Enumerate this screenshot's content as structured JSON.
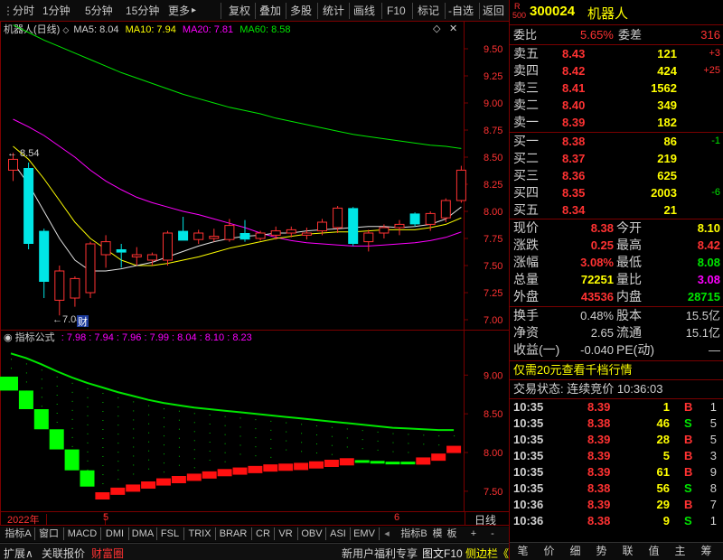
{
  "toolbar": {
    "items": [
      "分时",
      "1分钟",
      "5分钟",
      "15分钟",
      "更多",
      "复权",
      "叠加",
      "多股",
      "统计",
      "画线",
      "F10",
      "标记",
      "-自选",
      "返回"
    ],
    "more_arrow": "▸"
  },
  "main_chart": {
    "title": "机器人(日线)",
    "ma5_label": "MA5: 8.04",
    "ma10_label": "MA10: 7.94",
    "ma20_label": "MA20: 7.81",
    "ma60_label": "MA60: 8.58",
    "y_ticks": [
      "9.50",
      "9.25",
      "9.00",
      "8.75",
      "8.50",
      "8.25",
      "8.00",
      "7.75",
      "7.50",
      "7.25",
      "7.00"
    ],
    "high_label": "8.54",
    "low_label": "7.04",
    "finance_marker": "财",
    "colors": {
      "ma5": "#e0e0e0",
      "ma10": "#ffff00",
      "ma20": "#ff00ff",
      "ma60": "#00e600",
      "up": "#ff3232",
      "down": "#00e5e5"
    }
  },
  "indicator_chart": {
    "title": "指标公式",
    "values_text": ": 7.98 : 7.94 : 7.96 : 7.99 : 8.04 : 8.10 : 8.23",
    "y_ticks": [
      "9.00",
      "8.50",
      "8.00",
      "7.50"
    ]
  },
  "time_axis": {
    "labels": [
      "2022年",
      "5",
      "6"
    ],
    "period": "日线"
  },
  "chart_data": [
    {
      "type": "candlestick",
      "title": "机器人(日线)",
      "ylim": [
        6.95,
        9.65
      ],
      "candles": [
        {
          "o": 8.38,
          "h": 8.54,
          "l": 8.28,
          "c": 8.48
        },
        {
          "o": 8.4,
          "h": 8.45,
          "l": 7.65,
          "c": 7.7
        },
        {
          "o": 7.82,
          "h": 7.84,
          "l": 7.2,
          "c": 7.35
        },
        {
          "o": 7.18,
          "h": 7.5,
          "l": 7.04,
          "c": 7.45
        },
        {
          "o": 7.2,
          "h": 7.4,
          "l": 7.12,
          "c": 7.38
        },
        {
          "o": 7.25,
          "h": 7.72,
          "l": 7.2,
          "c": 7.7
        },
        {
          "o": 7.6,
          "h": 7.78,
          "l": 7.48,
          "c": 7.72
        },
        {
          "o": 7.65,
          "h": 7.7,
          "l": 7.48,
          "c": 7.62
        },
        {
          "o": 7.58,
          "h": 7.67,
          "l": 7.5,
          "c": 7.6
        },
        {
          "o": 7.55,
          "h": 7.62,
          "l": 7.5,
          "c": 7.6
        },
        {
          "o": 7.55,
          "h": 7.82,
          "l": 7.5,
          "c": 7.8
        },
        {
          "o": 7.82,
          "h": 7.95,
          "l": 7.73,
          "c": 7.73
        },
        {
          "o": 7.74,
          "h": 7.83,
          "l": 7.7,
          "c": 7.8
        },
        {
          "o": 7.75,
          "h": 7.84,
          "l": 7.72,
          "c": 7.77
        },
        {
          "o": 7.74,
          "h": 7.93,
          "l": 7.72,
          "c": 7.87
        },
        {
          "o": 7.8,
          "h": 7.92,
          "l": 7.72,
          "c": 7.74
        },
        {
          "o": 7.75,
          "h": 7.82,
          "l": 7.73,
          "c": 7.8
        },
        {
          "o": 7.78,
          "h": 7.86,
          "l": 7.74,
          "c": 7.82
        },
        {
          "o": 7.8,
          "h": 7.86,
          "l": 7.76,
          "c": 7.83
        },
        {
          "o": 7.78,
          "h": 7.85,
          "l": 7.74,
          "c": 7.8
        },
        {
          "o": 7.82,
          "h": 7.93,
          "l": 7.78,
          "c": 7.9
        },
        {
          "o": 7.85,
          "h": 8.05,
          "l": 7.8,
          "c": 8.03
        },
        {
          "o": 8.03,
          "h": 8.04,
          "l": 7.68,
          "c": 7.7
        },
        {
          "o": 7.72,
          "h": 7.83,
          "l": 7.63,
          "c": 7.8
        },
        {
          "o": 7.8,
          "h": 7.88,
          "l": 7.75,
          "c": 7.85
        },
        {
          "o": 7.85,
          "h": 7.92,
          "l": 7.78,
          "c": 7.88
        },
        {
          "o": 7.98,
          "h": 7.99,
          "l": 7.86,
          "c": 7.88
        },
        {
          "o": 7.88,
          "h": 8.0,
          "l": 7.82,
          "c": 7.98
        },
        {
          "o": 7.94,
          "h": 8.12,
          "l": 7.9,
          "c": 8.1
        },
        {
          "o": 8.1,
          "h": 8.42,
          "l": 8.08,
          "c": 8.38
        }
      ],
      "ma5": [
        8.45,
        8.25,
        8.0,
        7.75,
        7.55,
        7.45,
        7.45,
        7.47,
        7.5,
        7.53,
        7.58,
        7.63,
        7.68,
        7.72,
        7.75,
        7.77,
        7.78,
        7.8,
        7.8,
        7.82,
        7.83,
        7.84,
        7.85,
        7.86,
        7.86,
        7.85,
        7.86,
        7.88,
        7.93,
        8.04
      ],
      "ma10": [
        8.6,
        8.48,
        8.3,
        8.1,
        7.9,
        7.75,
        7.65,
        7.55,
        7.5,
        7.5,
        7.52,
        7.55,
        7.58,
        7.62,
        7.66,
        7.69,
        7.72,
        7.75,
        7.77,
        7.79,
        7.8,
        7.81,
        7.81,
        7.82,
        7.83,
        7.83,
        7.83,
        7.85,
        7.88,
        7.94
      ],
      "ma20": [
        8.85,
        8.78,
        8.7,
        8.6,
        8.5,
        8.38,
        8.28,
        8.2,
        8.13,
        8.08,
        8.04,
        8.0,
        7.97,
        7.93,
        7.89,
        7.85,
        7.8,
        7.76,
        7.73,
        7.71,
        7.7,
        7.69,
        7.68,
        7.68,
        7.69,
        7.7,
        7.71,
        7.73,
        7.76,
        7.81
      ],
      "ma60": [
        9.72,
        9.65,
        9.58,
        9.52,
        9.46,
        9.4,
        9.34,
        9.28,
        9.23,
        9.18,
        9.13,
        9.08,
        9.04,
        9.0,
        8.96,
        8.93,
        8.9,
        8.86,
        8.83,
        8.8,
        8.77,
        8.74,
        8.71,
        8.69,
        8.67,
        8.65,
        8.63,
        8.61,
        8.6,
        8.58
      ]
    },
    {
      "type": "line",
      "title": "指标公式",
      "ylim": [
        7.3,
        9.4
      ],
      "upper_line": [
        9.28,
        9.22,
        9.14,
        9.05,
        8.97,
        8.9,
        8.84,
        8.78,
        8.73,
        8.68,
        8.64,
        8.61,
        8.58,
        8.56,
        8.54,
        8.52,
        8.5,
        8.48,
        8.46,
        8.44,
        8.42,
        8.4,
        8.38,
        8.36,
        8.34,
        8.32,
        8.31,
        8.3,
        8.29,
        8.29
      ],
      "ladder": [
        8.8,
        8.56,
        8.3,
        8.04,
        7.77,
        7.56,
        7.44,
        7.5,
        7.54,
        7.58,
        7.62,
        7.65,
        7.68,
        7.71,
        7.74,
        7.76,
        7.78,
        7.8,
        7.81,
        7.82,
        7.84,
        7.86,
        7.88,
        7.89,
        7.88,
        7.87,
        7.87,
        7.89,
        7.94,
        8.04
      ],
      "ladder_up": [
        false,
        false,
        false,
        false,
        false,
        false,
        true,
        true,
        true,
        true,
        true,
        true,
        true,
        true,
        true,
        true,
        true,
        true,
        true,
        true,
        true,
        true,
        true,
        false,
        false,
        false,
        false,
        true,
        true,
        true
      ]
    }
  ],
  "quote": {
    "stock_code": "300024",
    "stock_name": "机器人",
    "badge_top": "R",
    "badge_bottom": "500",
    "weibi_label": "委比",
    "weibi_value": "5.65%",
    "weicha_label": "委差",
    "weicha_value": "316",
    "asks": [
      {
        "label": "卖五",
        "price": "8.43",
        "vol": "121",
        "chg": "+3"
      },
      {
        "label": "卖四",
        "price": "8.42",
        "vol": "424",
        "chg": "+25"
      },
      {
        "label": "卖三",
        "price": "8.41",
        "vol": "1562",
        "chg": ""
      },
      {
        "label": "卖二",
        "price": "8.40",
        "vol": "349",
        "chg": ""
      },
      {
        "label": "卖一",
        "price": "8.39",
        "vol": "182",
        "chg": ""
      }
    ],
    "bids": [
      {
        "label": "买一",
        "price": "8.38",
        "vol": "86",
        "chg": "-1"
      },
      {
        "label": "买二",
        "price": "8.37",
        "vol": "219",
        "chg": ""
      },
      {
        "label": "买三",
        "price": "8.36",
        "vol": "625",
        "chg": ""
      },
      {
        "label": "买四",
        "price": "8.35",
        "vol": "2003",
        "chg": "-6"
      },
      {
        "label": "买五",
        "price": "8.34",
        "vol": "21",
        "chg": ""
      }
    ],
    "stats": [
      {
        "l1": "现价",
        "v1": "8.38",
        "l2": "今开",
        "v2": "8.10"
      },
      {
        "l1": "涨跌",
        "v1": "0.25",
        "l2": "最高",
        "v2": "8.42"
      },
      {
        "l1": "涨幅",
        "v1": "3.08%",
        "l2": "最低",
        "v2": "8.08"
      },
      {
        "l1": "总量",
        "v1": "72251",
        "l2": "量比",
        "v2": "3.08"
      },
      {
        "l1": "外盘",
        "v1": "43536",
        "l2": "内盘",
        "v2": "28715"
      }
    ],
    "stats2": [
      {
        "l1": "换手",
        "v1": "0.48%",
        "l2": "股本",
        "v2": "15.5亿"
      },
      {
        "l1": "净资",
        "v1": "2.65",
        "l2": "流通",
        "v2": "15.1亿"
      },
      {
        "l1": "收益(一)",
        "v1": "-0.040",
        "l2": "PE(动)",
        "v2": "—"
      }
    ],
    "promo": "仅需20元查看千档行情",
    "trade_status": "交易状态: 连续竞价 10:36:03",
    "ticks": [
      {
        "time": "10:35",
        "price": "8.39",
        "vol": "1",
        "bs": "B",
        "n": "1"
      },
      {
        "time": "10:35",
        "price": "8.38",
        "vol": "46",
        "bs": "S",
        "n": "5"
      },
      {
        "time": "10:35",
        "price": "8.39",
        "vol": "28",
        "bs": "B",
        "n": "5"
      },
      {
        "time": "10:35",
        "price": "8.39",
        "vol": "5",
        "bs": "B",
        "n": "3"
      },
      {
        "time": "10:35",
        "price": "8.39",
        "vol": "61",
        "bs": "B",
        "n": "9"
      },
      {
        "time": "10:35",
        "price": "8.38",
        "vol": "56",
        "bs": "S",
        "n": "8"
      },
      {
        "time": "10:36",
        "price": "8.39",
        "vol": "29",
        "bs": "B",
        "n": "7"
      },
      {
        "time": "10:36",
        "price": "8.38",
        "vol": "9",
        "bs": "S",
        "n": "1"
      }
    ]
  },
  "indicator_tabs": [
    "指标A",
    "窗口",
    "MACD",
    "DMI",
    "DMA",
    "FSL",
    "TRIX",
    "BRAR",
    "CR",
    "VR",
    "OBV",
    "ASI",
    "EMV"
  ],
  "indicator_tab_right": [
    "指标B",
    "模",
    "板",
    "+",
    "-"
  ],
  "status_bar": {
    "left": [
      "扩展∧",
      "关联报价",
      "财富圈"
    ],
    "promo": "新用户福利专享",
    "fast": "图文F10",
    "side": "侧边栏《"
  },
  "right_nav": [
    "笔",
    "价",
    "细",
    "势",
    "联",
    "值",
    "主",
    "筹"
  ]
}
